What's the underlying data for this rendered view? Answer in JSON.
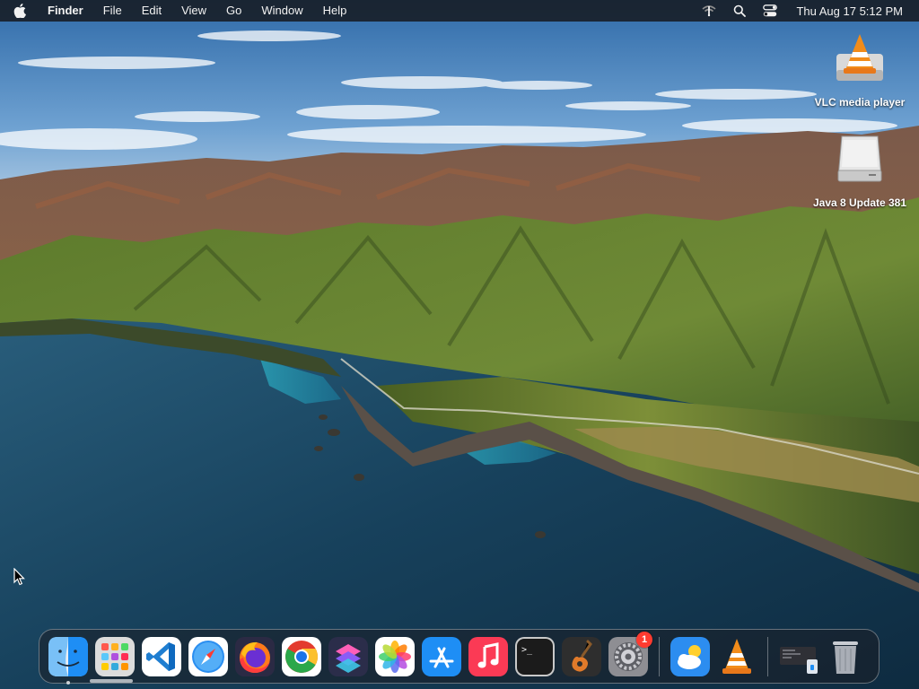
{
  "menubar": {
    "app_name": "Finder",
    "items": [
      "File",
      "Edit",
      "View",
      "Go",
      "Window",
      "Help"
    ],
    "status_icons": [
      "wifi-off-icon",
      "search-icon",
      "control-center-icon"
    ],
    "clock": "Thu Aug 17  5:12 PM"
  },
  "desktop": {
    "wallpaper": "Big Sur coastline",
    "icons": [
      {
        "label": "VLC media player",
        "icon": "vlc-icon"
      },
      {
        "label": "Java 8 Update 381",
        "icon": "disk-image-icon"
      }
    ]
  },
  "dock": {
    "apps": [
      {
        "name": "Finder",
        "icon": "finder-icon",
        "running": true
      },
      {
        "name": "Launchpad",
        "icon": "launchpad-icon"
      },
      {
        "name": "Visual Studio Code",
        "icon": "vscode-icon"
      },
      {
        "name": "Safari",
        "icon": "safari-icon"
      },
      {
        "name": "Firefox",
        "icon": "firefox-icon"
      },
      {
        "name": "Google Chrome",
        "icon": "chrome-icon"
      },
      {
        "name": "Shortcuts",
        "icon": "shortcuts-icon"
      },
      {
        "name": "Photos",
        "icon": "photos-icon"
      },
      {
        "name": "App Store",
        "icon": "app-store-icon"
      },
      {
        "name": "Music",
        "icon": "music-icon"
      },
      {
        "name": "Terminal",
        "icon": "terminal-icon"
      },
      {
        "name": "GarageBand",
        "icon": "garageband-icon"
      },
      {
        "name": "System Settings",
        "icon": "settings-icon",
        "badge": "1"
      }
    ],
    "recent": [
      {
        "name": "Weather",
        "icon": "weather-icon"
      },
      {
        "name": "VLC",
        "icon": "vlc-icon"
      }
    ],
    "stack": [
      {
        "name": "Downloads",
        "icon": "downloads-stack-icon"
      },
      {
        "name": "Trash",
        "icon": "trash-icon"
      }
    ],
    "terminal_prompt": ">_"
  },
  "colors": {
    "menubar_bg": "#161a20",
    "badge_red": "#ff3b30",
    "sea": "#1d4e6b",
    "hills_green": "#5e7a2f"
  }
}
